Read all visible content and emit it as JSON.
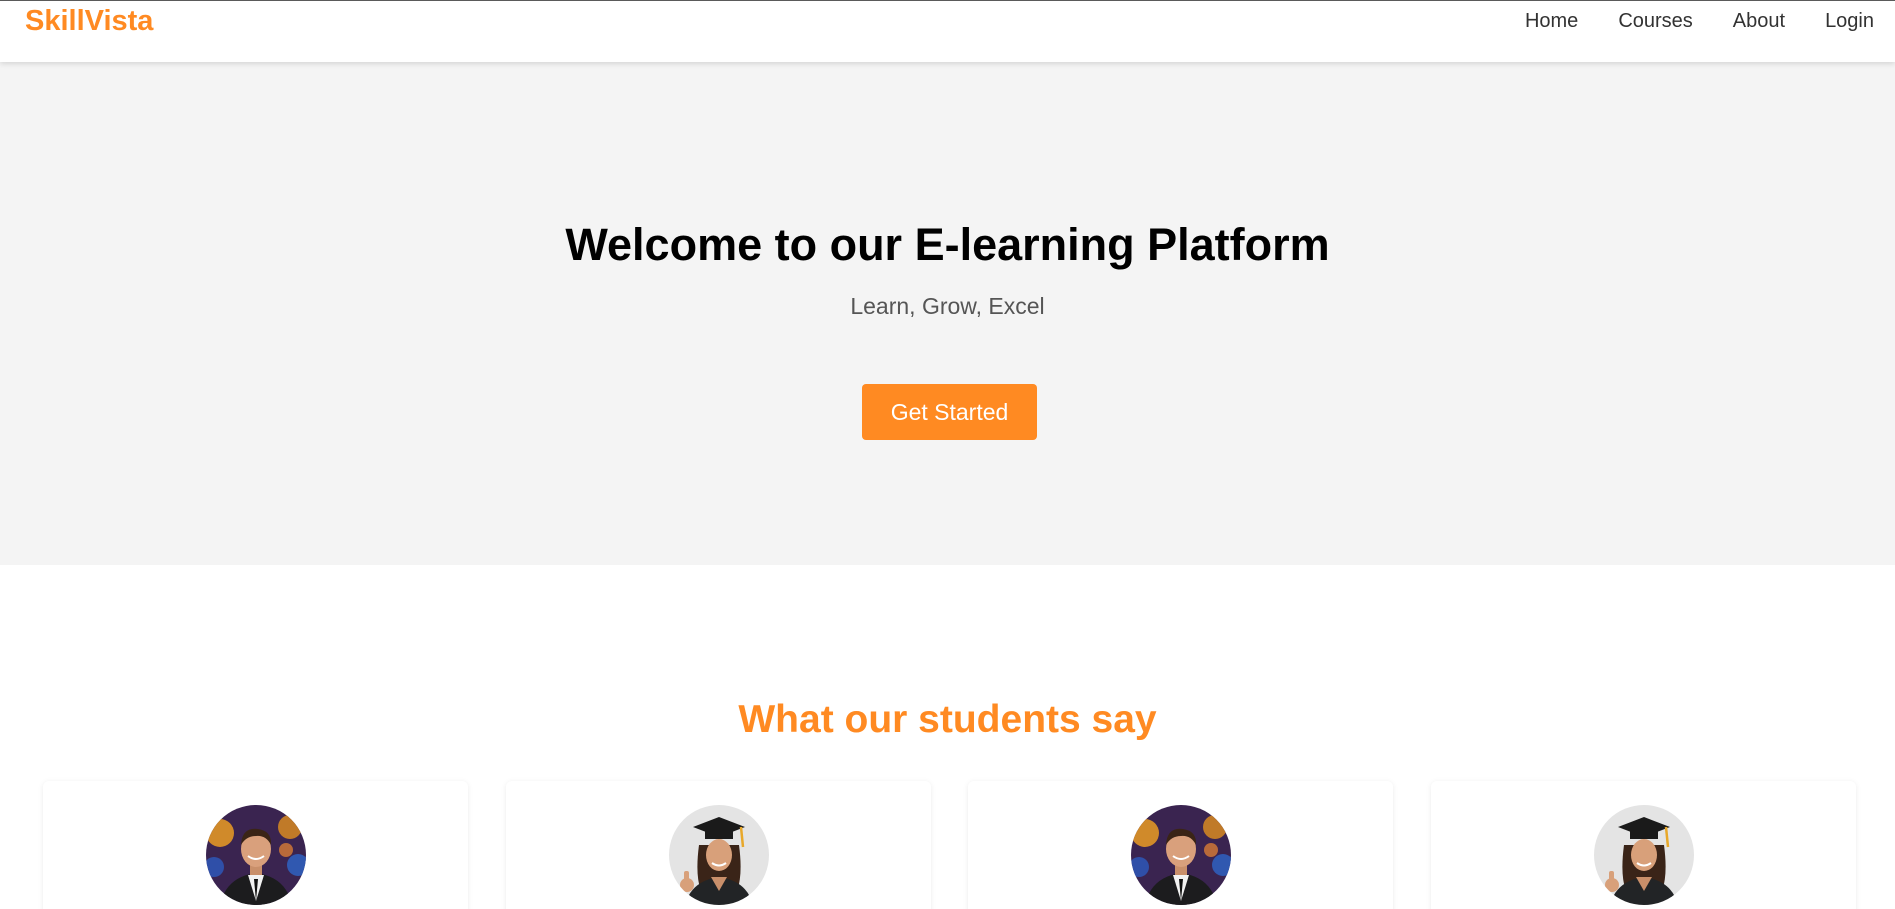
{
  "navbar": {
    "brand": "SkillVista",
    "links": [
      "Home",
      "Courses",
      "About",
      "Login"
    ]
  },
  "hero": {
    "title": "Welcome to our E-learning Platform",
    "subtitle": "Learn, Grow, Excel",
    "cta_label": "Get Started"
  },
  "testimonials": {
    "title": "What our students say",
    "cards": [
      {
        "avatar": "male-student-photo"
      },
      {
        "avatar": "female-graduate-photo"
      },
      {
        "avatar": "male-student-photo"
      },
      {
        "avatar": "female-graduate-photo"
      }
    ]
  },
  "colors": {
    "accent": "#ff8a22",
    "hero_background": "#f4f4f4",
    "text_dark": "#000000",
    "text_muted": "#555555"
  }
}
